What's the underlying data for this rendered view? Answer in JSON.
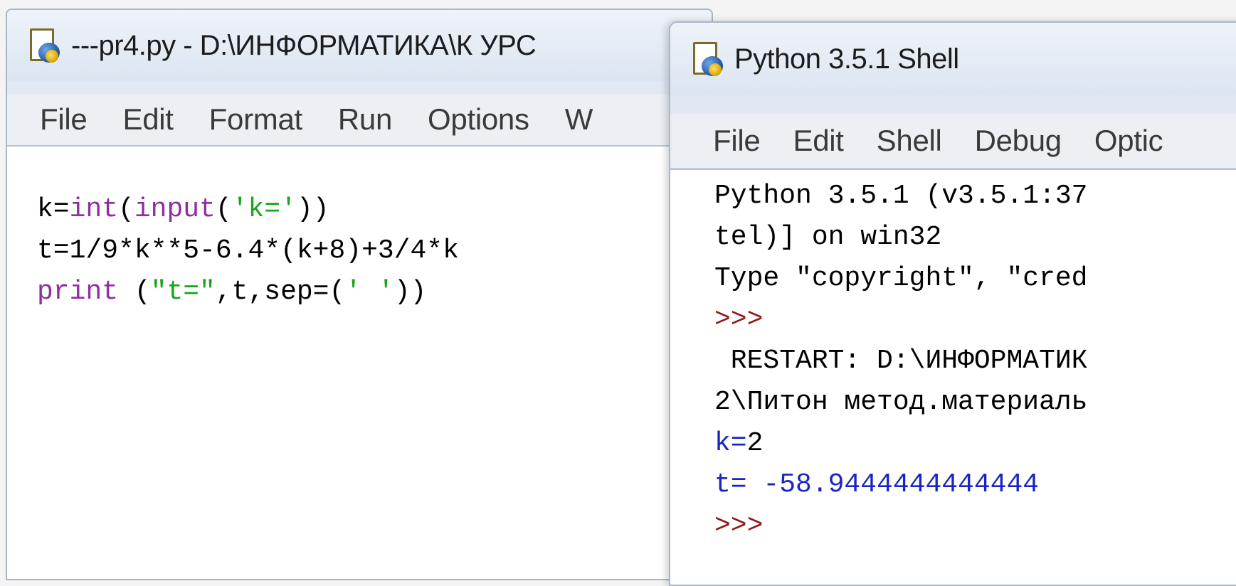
{
  "editor": {
    "title": "---pr4.py - D:\\ИНФОРМАТИКА\\К УРС",
    "menu": [
      "File",
      "Edit",
      "Format",
      "Run",
      "Options",
      "W"
    ],
    "code_lines": [
      [
        {
          "t": "k=",
          "c": "plain"
        },
        {
          "t": "int",
          "c": "kw-builtin"
        },
        {
          "t": "(",
          "c": "plain"
        },
        {
          "t": "input",
          "c": "kw-builtin"
        },
        {
          "t": "(",
          "c": "plain"
        },
        {
          "t": "'k='",
          "c": "str"
        },
        {
          "t": "))",
          "c": "plain"
        }
      ],
      [
        {
          "t": "t=1/9*k**5-6.4*(k+8)+3/4*k",
          "c": "plain"
        }
      ],
      [
        {
          "t": "print",
          "c": "kw-builtin"
        },
        {
          "t": " (",
          "c": "plain"
        },
        {
          "t": "\"t=\"",
          "c": "str"
        },
        {
          "t": ",t,sep=(",
          "c": "plain"
        },
        {
          "t": "' '",
          "c": "str"
        },
        {
          "t": "))",
          "c": "plain"
        }
      ]
    ]
  },
  "shell": {
    "title": "Python 3.5.1 Shell",
    "menu": [
      "File",
      "Edit",
      "Shell",
      "Debug",
      "Optic"
    ],
    "lines": [
      [
        {
          "t": "Python 3.5.1 (v3.5.1:37",
          "c": "plain"
        }
      ],
      [
        {
          "t": "tel)] on win32",
          "c": "plain"
        }
      ],
      [
        {
          "t": "Type \"copyright\", \"cred",
          "c": "plain"
        }
      ],
      [
        {
          "t": ">>>",
          "c": "prompt"
        }
      ],
      [
        {
          "t": " RESTART: D:\\ИНФОРМАТИК",
          "c": "plain"
        }
      ],
      [
        {
          "t": "2\\Питон метод.материаль",
          "c": "plain"
        }
      ],
      [
        {
          "t": "k=",
          "c": "out"
        },
        {
          "t": "2",
          "c": "plain"
        }
      ],
      [
        {
          "t": "t= -58.9444444444444",
          "c": "out"
        }
      ],
      [
        {
          "t": ">>>",
          "c": "prompt"
        }
      ]
    ]
  },
  "colors": {
    "builtin": "#8f2e9e",
    "string": "#1aa31a",
    "prompt": "#8b1a1a",
    "output": "#1a24c4"
  }
}
